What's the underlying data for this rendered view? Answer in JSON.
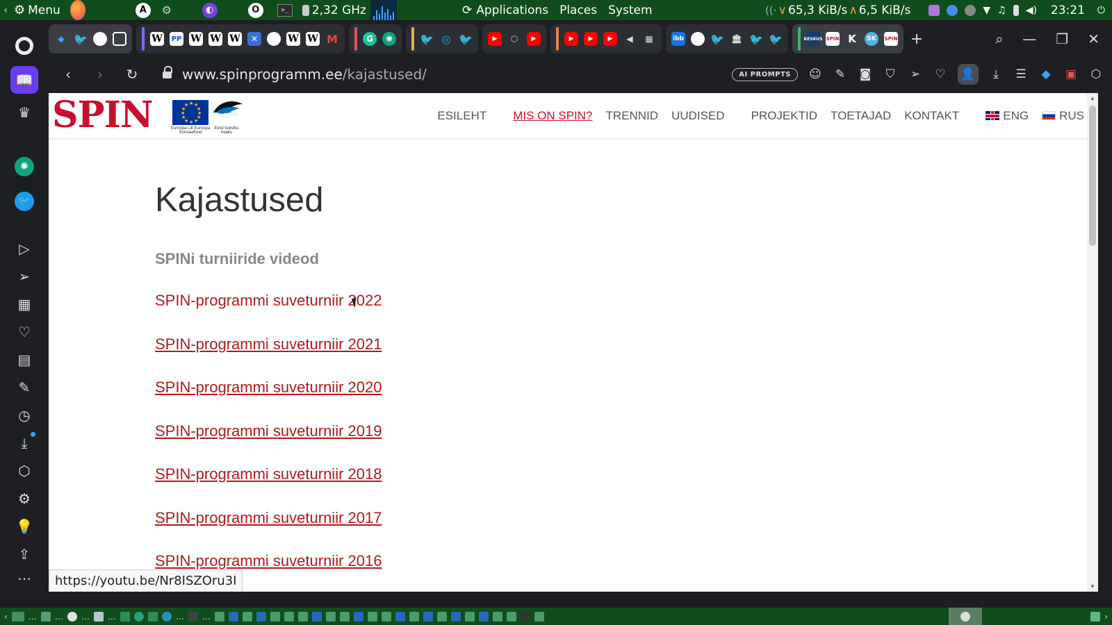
{
  "os_panel": {
    "menu_label": "Menu",
    "cpu_freq": "2,32 GHz",
    "applications_label": "Applications",
    "places_label": "Places",
    "system_label": "System",
    "net_down": "65,3 KiB/s",
    "net_up": "6,5 KiB/s",
    "clock": "23:21"
  },
  "browser": {
    "url_domain": "www.spinprogramm.ee",
    "url_path": "/kajastused/",
    "ai_prompts_label": "AI PROMPTS",
    "status_link": "https://youtu.be/Nr8ISZOru3I",
    "tab_icons": [
      "pin-icon",
      "twitter-icon",
      "globe-icon",
      "calendar-icon",
      "wikipedia-icon",
      "pp-icon",
      "wikipedia-icon",
      "wikipedia-icon",
      "wikipedia-icon",
      "x-icon",
      "globe-icon",
      "wikipedia-icon",
      "wikipedia-icon",
      "gmail-icon",
      "grammarly-icon",
      "chatgpt-icon",
      "twitter-icon",
      "telegram-icon",
      "twitter-icon",
      "youtube-icon",
      "box-icon",
      "youtube-icon",
      "youtube-icon",
      "youtube-icon",
      "youtube-icon",
      "speaker-icon",
      "grid-icon",
      "ibb-icon",
      "globe-icon",
      "twitter-icon",
      "library-icon",
      "twitter-icon",
      "twitter-icon",
      "keskus-icon",
      "spin-icon",
      "k-icon",
      "sk-icon",
      "spin-icon"
    ]
  },
  "site": {
    "logo_text": "SPIN",
    "eu_caption": "Euroopa Liit Euroopa Sotsiaalfond",
    "ee_caption": "Eesti tuleviku heaks",
    "nav": {
      "home": "ESILEHT",
      "what_is_spin": "MIS ON SPIN?",
      "trends": "TRENNID",
      "news": "UUDISED",
      "projects": "PROJEKTID",
      "supporters": "TOETAJAD",
      "contact": "KONTAKT",
      "lang_eng": "ENG",
      "lang_rus": "RUS"
    }
  },
  "page": {
    "title": "Kajastused",
    "section_heading": "SPINi turniiride videod",
    "videos": [
      "SPIN-programmi suveturniir 2022",
      "SPIN-programmi suveturniir 2021",
      "SPIN-programmi suveturniir 2020",
      "SPIN-programmi suveturniir 2019",
      "SPIN-programmi suveturniir 2018",
      "SPIN-programmi suveturniir 2017",
      "SPIN-programmi suveturniir 2016"
    ]
  },
  "colors": {
    "os_panel": "#0f4d1c",
    "browser_dark": "#1d1f22",
    "spin_red": "#c8102e",
    "link_red": "#b11a1a",
    "sidebar_accent": "#6a3df5"
  }
}
